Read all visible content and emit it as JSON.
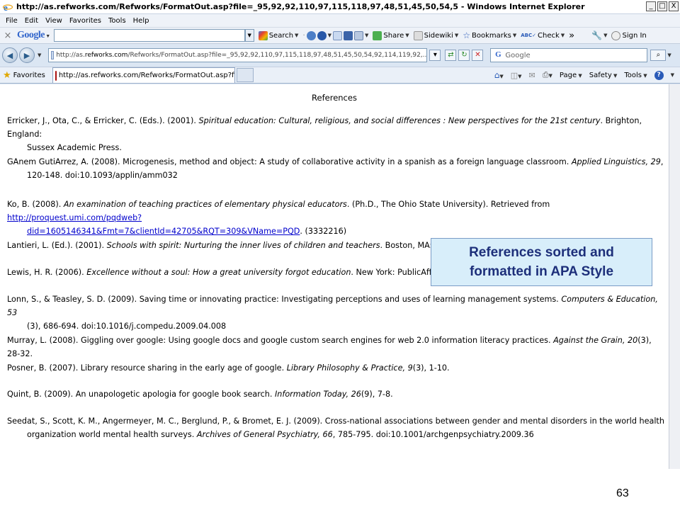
{
  "window": {
    "title": "http://as.refworks.com/Refworks/FormatOut.asp?file=_95,92,92,110,97,115,118,97,48,51,45,50,54,5 - Windows Internet Explorer",
    "controls": [
      "_",
      "□",
      "X"
    ]
  },
  "menu": [
    "File",
    "Edit",
    "View",
    "Favorites",
    "Tools",
    "Help"
  ],
  "google_toolbar": {
    "close": "×",
    "logo": "Google",
    "search_label": "Search",
    "share_label": "Share",
    "sidewiki_label": "Sidewiki",
    "bookmarks_label": "Bookmarks",
    "check_label": "Check",
    "more": "»",
    "signin_label": "Sign In"
  },
  "address_bar": {
    "url_prefix": "http://as.",
    "url_domain": "refworks.com",
    "url_rest": "/Refworks/FormatOut.asp?file=_95,92,92,110,97,115,118,97,48,51,45,50,54,92,114,119,92,..",
    "search_placeholder": "Google"
  },
  "favorites_bar": {
    "favorites_label": "Favorites",
    "tab_title": "http://as.refworks.com/Refworks/FormatOut.asp?file...",
    "page_label": "Page",
    "safety_label": "Safety",
    "tools_label": "Tools"
  },
  "content": {
    "heading": "References",
    "refs": [
      {
        "pre": "Erricker, J., Ota, C., & Erricker, C. (Eds.). (2001). ",
        "italic": "Spiritual education: Cultural, religious, and social differences : New perspectives for the 21st century",
        "post": ". Brighton, England:",
        "line2": "Sussex Academic Press."
      },
      {
        "pre": "GAnem GutiArrez, A. (2008). Microgenesis, method and object: A study of collaborative activity in a spanish as a foreign language classroom. ",
        "italic": "Applied Linguistics, 29",
        "post": ",",
        "line2": "120-148. doi:10.1093/applin/amm032"
      },
      {
        "pre": "Ko, B. (2008). ",
        "italic": "An examination of teaching practices of elementary physical educators",
        "post": ". (Ph.D., The Ohio State University). Retrieved from ",
        "link1": "http://proquest.umi.com/pqdweb?",
        "link2": "did=1605146341&Fmt=7&clientId=42705&RQT=309&VName=PQD",
        "line2_post": ". (3332216)"
      },
      {
        "pre": "Lantieri, L. (Ed.). (2001). ",
        "italic": "Schools with spirit: Nurturing the inner lives of children and teachers",
        "post": ". Boston, MA: Beacon Press."
      },
      {
        "pre": "Lewis, H. R. (2006). ",
        "italic": "Excellence without a soul: How a great university forgot education",
        "post": ". New York: PublicAffairs."
      },
      {
        "pre": "Lonn, S., & Teasley, S. D. (2009). Saving time or innovating practice: Investigating perceptions and uses of learning management systems. ",
        "italic": "Computers & Education, 53",
        "post": "",
        "line2": "(3), 686-694. doi:10.1016/j.compedu.2009.04.008"
      },
      {
        "pre": "Murray, L. (2008). Giggling over google: Using google docs and google custom search engines for web 2.0 information literacy practices. ",
        "italic": "Against the Grain, 20",
        "post": "(3), 28-32."
      },
      {
        "pre": "Posner, B. (2007). Library resource sharing in the early age of google. ",
        "italic": "Library Philosophy & Practice, 9",
        "post": "(3), 1-10."
      },
      {
        "pre": "Quint, B. (2009). An unapologetic apologia for google book search. ",
        "italic": "Information Today, 26",
        "post": "(9), 7-8."
      },
      {
        "pre": "Seedat, S., Scott, K. M., Angermeyer, M. C., Berglund, P., & Bromet, E. J. (2009). Cross-national associations between gender and mental disorders in the world health",
        "italic": "",
        "post": "",
        "line2_pre": "organization world mental health surveys. ",
        "line2_italic": "Archives of General Psychiatry, 66",
        "line2_post": ", 785-795. doi:10.1001/archgenpsychiatry.2009.36"
      }
    ]
  },
  "callout": {
    "line1": "References sorted and",
    "line2": "formatted in APA Style"
  },
  "slide_number": "63",
  "colors": {
    "callout_bg": "#d8eefa",
    "callout_text": "#1d2f7a",
    "link": "#0000cc",
    "chrome": "#dbe6f3"
  }
}
